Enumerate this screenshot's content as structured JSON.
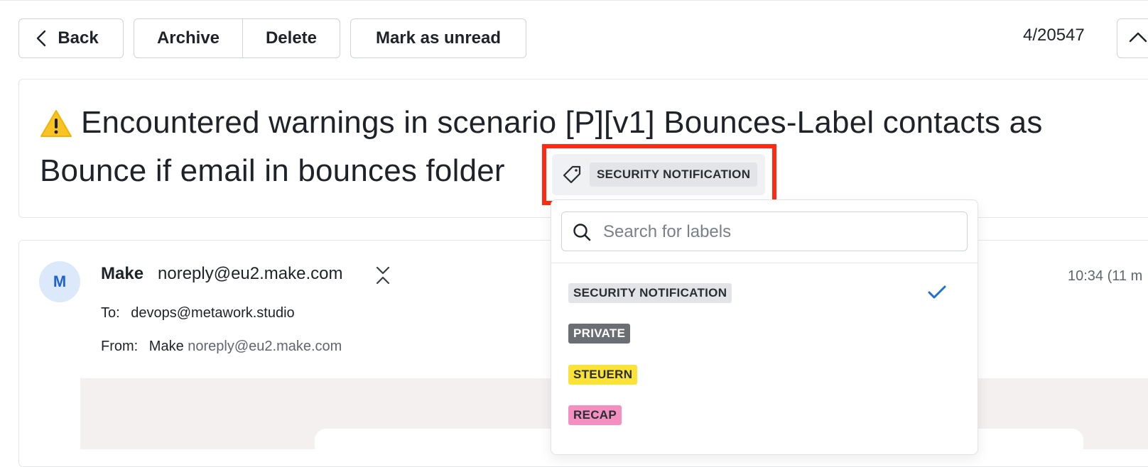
{
  "toolbar": {
    "back_label": "Back",
    "archive_label": "Archive",
    "delete_label": "Delete",
    "mark_unread_label": "Mark as unread",
    "counter": "4/20547"
  },
  "subject": {
    "line1": "Encountered warnings in scenario [P][v1] Bounces-Label contacts as",
    "line2": "Bounce if email in bounces folder",
    "applied_label": "SECURITY NOTIFICATION",
    "icons": [
      "warning-icon",
      "tag-icon"
    ]
  },
  "email": {
    "avatar_initial": "M",
    "sender_name": "Make",
    "sender_email": "noreply@eu2.make.com",
    "to_label": "To:",
    "to_value": "devops@metawork.studio",
    "from_label": "From:",
    "from_name": "Make",
    "from_email": "noreply@eu2.make.com",
    "time": "10:34 (11 m"
  },
  "label_dropdown": {
    "search_placeholder": "Search for labels",
    "items": [
      {
        "label": "SECURITY NOTIFICATION",
        "bg": "#e2e4e7",
        "fg": "#2a2e33",
        "checked": true
      },
      {
        "label": "PRIVATE",
        "bg": "#6b6e72",
        "fg": "#ffffff",
        "checked": false
      },
      {
        "label": "STEUERN",
        "bg": "#fbe236",
        "fg": "#2a2e33",
        "checked": false
      },
      {
        "label": "RECAP",
        "bg": "#f48fc1",
        "fg": "#2a2e33",
        "checked": false
      }
    ]
  },
  "colors": {
    "highlight": "#ff2a12",
    "check": "#1f6fd6",
    "avatar_bg": "#dce9fb",
    "avatar_fg": "#1f62d0"
  }
}
